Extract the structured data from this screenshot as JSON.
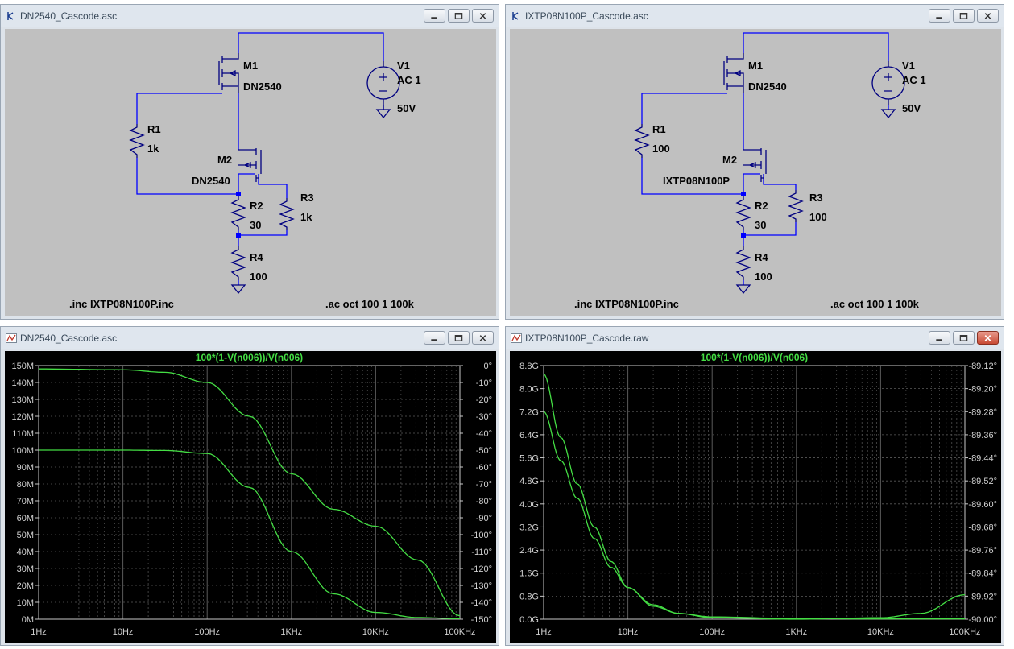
{
  "windows": {
    "schematic_left": {
      "title": "DN2540_Cascode.asc",
      "components": {
        "m1_name": "M1",
        "m1_model": "DN2540",
        "m2_name": "M2",
        "m2_model": "DN2540",
        "v1_name": "V1",
        "v1_ac": "AC 1",
        "v1_dc": "50V",
        "r1_name": "R1",
        "r1_value": "1k",
        "r2_name": "R2",
        "r2_value": "30",
        "r3_name": "R3",
        "r3_value": "1k",
        "r4_name": "R4",
        "r4_value": "100"
      },
      "directive_inc": ".inc IXTP08N100P.inc",
      "directive_ac": ".ac oct 100 1 100k"
    },
    "schematic_right": {
      "title": "IXTP08N100P_Cascode.asc",
      "components": {
        "m1_name": "M1",
        "m1_model": "DN2540",
        "m2_name": "M2",
        "m2_model": "IXTP08N100P",
        "v1_name": "V1",
        "v1_ac": "AC 1",
        "v1_dc": "50V",
        "r1_name": "R1",
        "r1_value": "100",
        "r2_name": "R2",
        "r2_value": "30",
        "r3_name": "R3",
        "r3_value": "100",
        "r4_name": "R4",
        "r4_value": "100"
      },
      "directive_inc": ".inc IXTP08N100P.inc",
      "directive_ac": ".ac oct 100 1 100k"
    },
    "plot_left": {
      "title": "DN2540_Cascode.asc"
    },
    "plot_right": {
      "title": "IXTP08N100P_Cascode.raw"
    }
  },
  "colors": {
    "trace": "#44dd44",
    "grid": "#5a5a5a",
    "wire": "#0000ff",
    "component": "#000080",
    "node": "#0000ff"
  },
  "chart_data": [
    {
      "type": "line",
      "title": "100*(1-V(n006))/V(n006)",
      "x_scale": "log",
      "xlim": [
        1,
        100000
      ],
      "x_ticks": [
        "1Hz",
        "10Hz",
        "100Hz",
        "1KHz",
        "10KHz",
        "100KHz"
      ],
      "ylim": [
        0,
        150000000
      ],
      "y_ticks": [
        "0M",
        "10M",
        "20M",
        "30M",
        "40M",
        "50M",
        "60M",
        "70M",
        "80M",
        "90M",
        "100M",
        "110M",
        "120M",
        "130M",
        "140M",
        "150M"
      ],
      "y2lim": [
        -150,
        0
      ],
      "y2_ticks": [
        "0°",
        "-10°",
        "-20°",
        "-30°",
        "-40°",
        "-50°",
        "-60°",
        "-70°",
        "-80°",
        "-90°",
        "-100°",
        "-110°",
        "-120°",
        "-130°",
        "-140°",
        "-150°"
      ],
      "grid": true,
      "series": [
        {
          "axis": "left",
          "x": [
            1,
            10,
            31.6,
            100,
            316,
            1000,
            3162,
            10000,
            31623,
            100000
          ],
          "values": [
            100000000,
            100000000,
            99800000,
            98000000,
            78000000,
            40000000,
            15000000,
            4000000,
            1000000,
            300000
          ]
        },
        {
          "axis": "right",
          "x": [
            1,
            10,
            31.6,
            100,
            316,
            1000,
            3162,
            10000,
            31623,
            100000
          ],
          "values": [
            -2,
            -2.5,
            -4,
            -10,
            -30,
            -64,
            -85,
            -95,
            -115,
            -148
          ]
        }
      ]
    },
    {
      "type": "line",
      "title": "100*(1-V(n006))/V(n006)",
      "x_scale": "log",
      "xlim": [
        1,
        100000
      ],
      "x_ticks": [
        "1Hz",
        "10Hz",
        "100Hz",
        "1KHz",
        "10KHz",
        "100KHz"
      ],
      "ylim": [
        0,
        8800000000
      ],
      "y_ticks": [
        "0.0G",
        "0.8G",
        "1.6G",
        "2.4G",
        "3.2G",
        "4.0G",
        "4.8G",
        "5.6G",
        "6.4G",
        "7.2G",
        "8.0G",
        "8.8G"
      ],
      "y2lim": [
        -90.0,
        -89.12
      ],
      "y2_ticks": [
        "-89.12°",
        "-89.20°",
        "-89.28°",
        "-89.36°",
        "-89.44°",
        "-89.52°",
        "-89.60°",
        "-89.68°",
        "-89.76°",
        "-89.84°",
        "-89.92°",
        "-90.00°"
      ],
      "grid": true,
      "series": [
        {
          "axis": "left",
          "x": [
            1,
            1.6,
            2.5,
            4,
            6.3,
            10,
            20,
            40,
            100,
            1000,
            10000,
            100000
          ],
          "values": [
            8500000000,
            6300000000,
            4700000000,
            3200000000,
            2000000000,
            1100000000,
            450000000,
            200000000,
            80000000,
            20000000,
            10000000,
            10000000
          ]
        },
        {
          "axis": "right",
          "x": [
            1,
            1.6,
            2.5,
            4,
            6.3,
            10,
            20,
            40,
            100,
            1000,
            10000,
            30000,
            100000
          ],
          "values": [
            -89.28,
            -89.45,
            -89.58,
            -89.72,
            -89.82,
            -89.89,
            -89.95,
            -89.98,
            -89.995,
            -90.0,
            -89.995,
            -89.98,
            -89.915
          ]
        }
      ]
    }
  ]
}
